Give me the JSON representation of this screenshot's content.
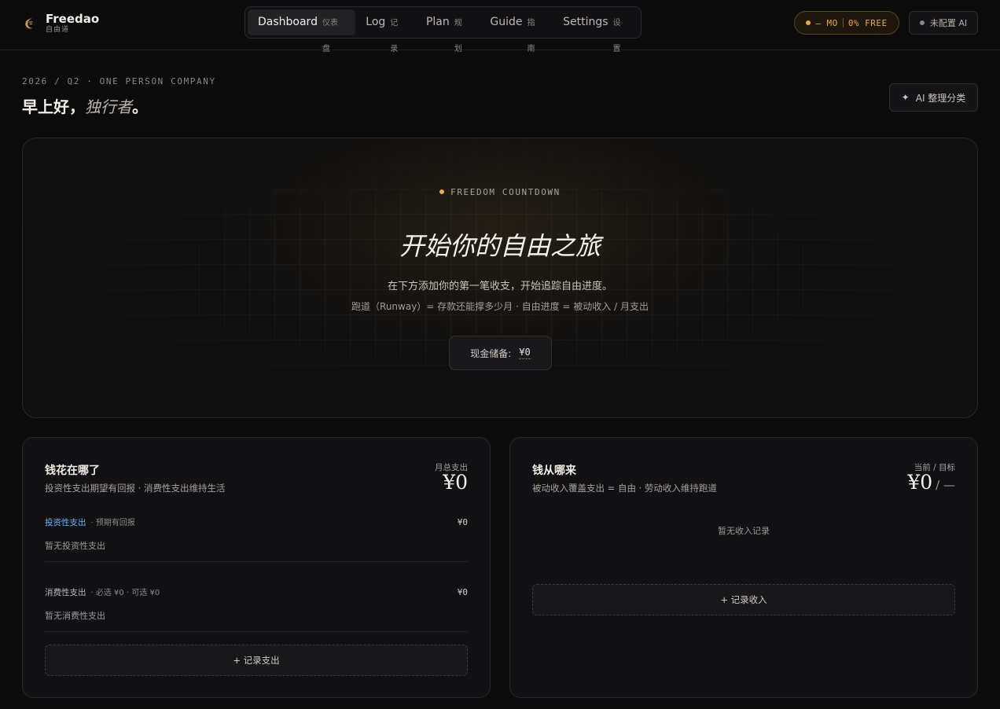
{
  "brand": {
    "title": "Freedao",
    "subtitle": "自由道",
    "logo_icon": "crescent-logo-icon",
    "accent": "#e5a94a"
  },
  "nav": {
    "tabs": [
      {
        "label": "Dashboard",
        "sublabel": "仪表盘",
        "active": true
      },
      {
        "label": "Log",
        "sublabel": "记录",
        "active": false
      },
      {
        "label": "Plan",
        "sublabel": "规划",
        "active": false
      },
      {
        "label": "Guide",
        "sublabel": "指南",
        "active": false
      },
      {
        "label": "Settings",
        "sublabel": "设置",
        "active": false
      }
    ]
  },
  "status": {
    "months": "— MO",
    "free": "0% FREE"
  },
  "ai_status": {
    "label": "未配置 AI"
  },
  "header": {
    "eyebrow": "2026 / Q2 · ONE PERSON COMPANY",
    "greeting_prefix": "早上好，",
    "greeting_name": "独行者",
    "greeting_suffix": "。",
    "ai_button": "AI 整理分类",
    "ai_button_icon": "sparkle-icon"
  },
  "hero": {
    "label": "FREEDOM COUNTDOWN",
    "title": "开始你的自由之旅",
    "description": "在下方添加你的第一笔收支，开始追踪自由进度。",
    "formula": "跑道（Runway）= 存款还能撑多少月 · 自由进度 = 被动收入 / 月支出",
    "cash_label": "现金储备:",
    "cash_value": "¥0"
  },
  "spending": {
    "title": "钱花在哪了",
    "subtitle": "投资性支出期望有回报 · 消费性支出维持生活",
    "stat_label": "月总支出",
    "stat_value": "¥0",
    "invest": {
      "name": "投资性支出",
      "meta": "· 预期有回报",
      "amount": "¥0",
      "empty": "暂无投资性支出"
    },
    "consume": {
      "name": "消费性支出",
      "meta": "· 必选 ¥0 · 可选 ¥0",
      "amount": "¥0",
      "empty": "暂无消费性支出"
    },
    "add_button": "+ 记录支出"
  },
  "income": {
    "title": "钱从哪来",
    "subtitle": "被动收入覆盖支出 = 自由 · 劳动收入维持跑道",
    "stat_label": "当前 / 目标",
    "stat_value": "¥0",
    "stat_target": "/ —",
    "empty": "暂无收入记录",
    "add_button": "+ 记录收入"
  }
}
